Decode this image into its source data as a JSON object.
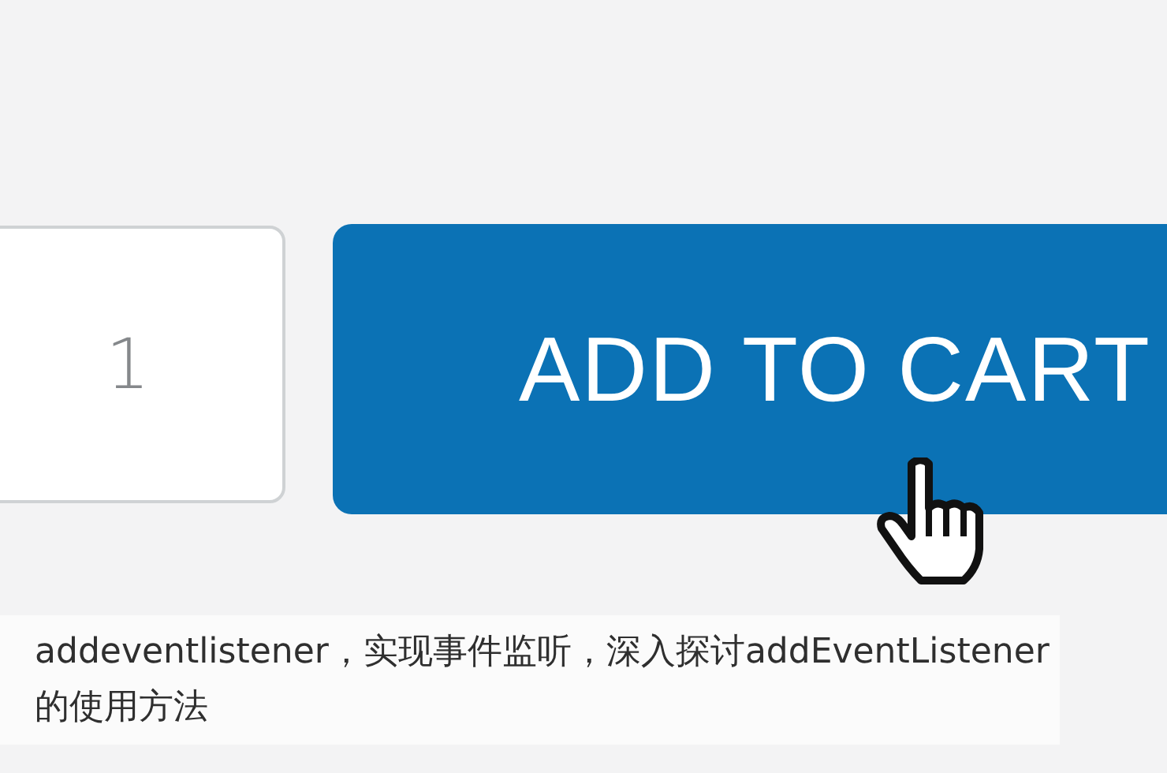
{
  "quantity_field": {
    "value": "1"
  },
  "add_to_cart_button": {
    "label": "ADD TO CART"
  },
  "caption": {
    "text": "addeventlistener，实现事件监听，深入探讨addEventListener的使用方法"
  }
}
